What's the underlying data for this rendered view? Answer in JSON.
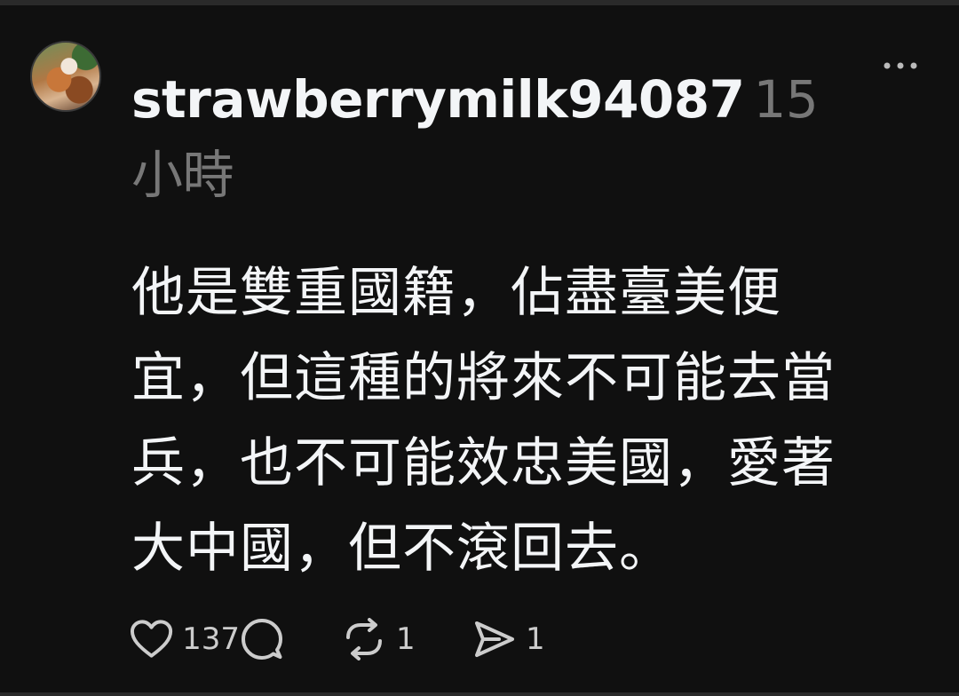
{
  "post": {
    "username": "strawberrymilk94087",
    "timestamp": "15小時",
    "avatar_icon": "avatar-photo",
    "more_icon": "more-icon",
    "body": "他是雙重國籍，佔盡臺美便\n宜，但這種的將來不可能去當\n兵，也不可能效忠美國，愛著\n大中國，但不滾回去。",
    "actions": {
      "like": {
        "icon": "heart-icon",
        "count": "137"
      },
      "reply": {
        "icon": "comment-icon"
      },
      "repost": {
        "icon": "repost-icon",
        "count": "1"
      },
      "share": {
        "icon": "share-icon",
        "count": "1"
      }
    }
  },
  "colors": {
    "background": "#101010",
    "primary_text": "#f3f5f7",
    "secondary_text": "#777777",
    "icon": "#cccccc"
  }
}
